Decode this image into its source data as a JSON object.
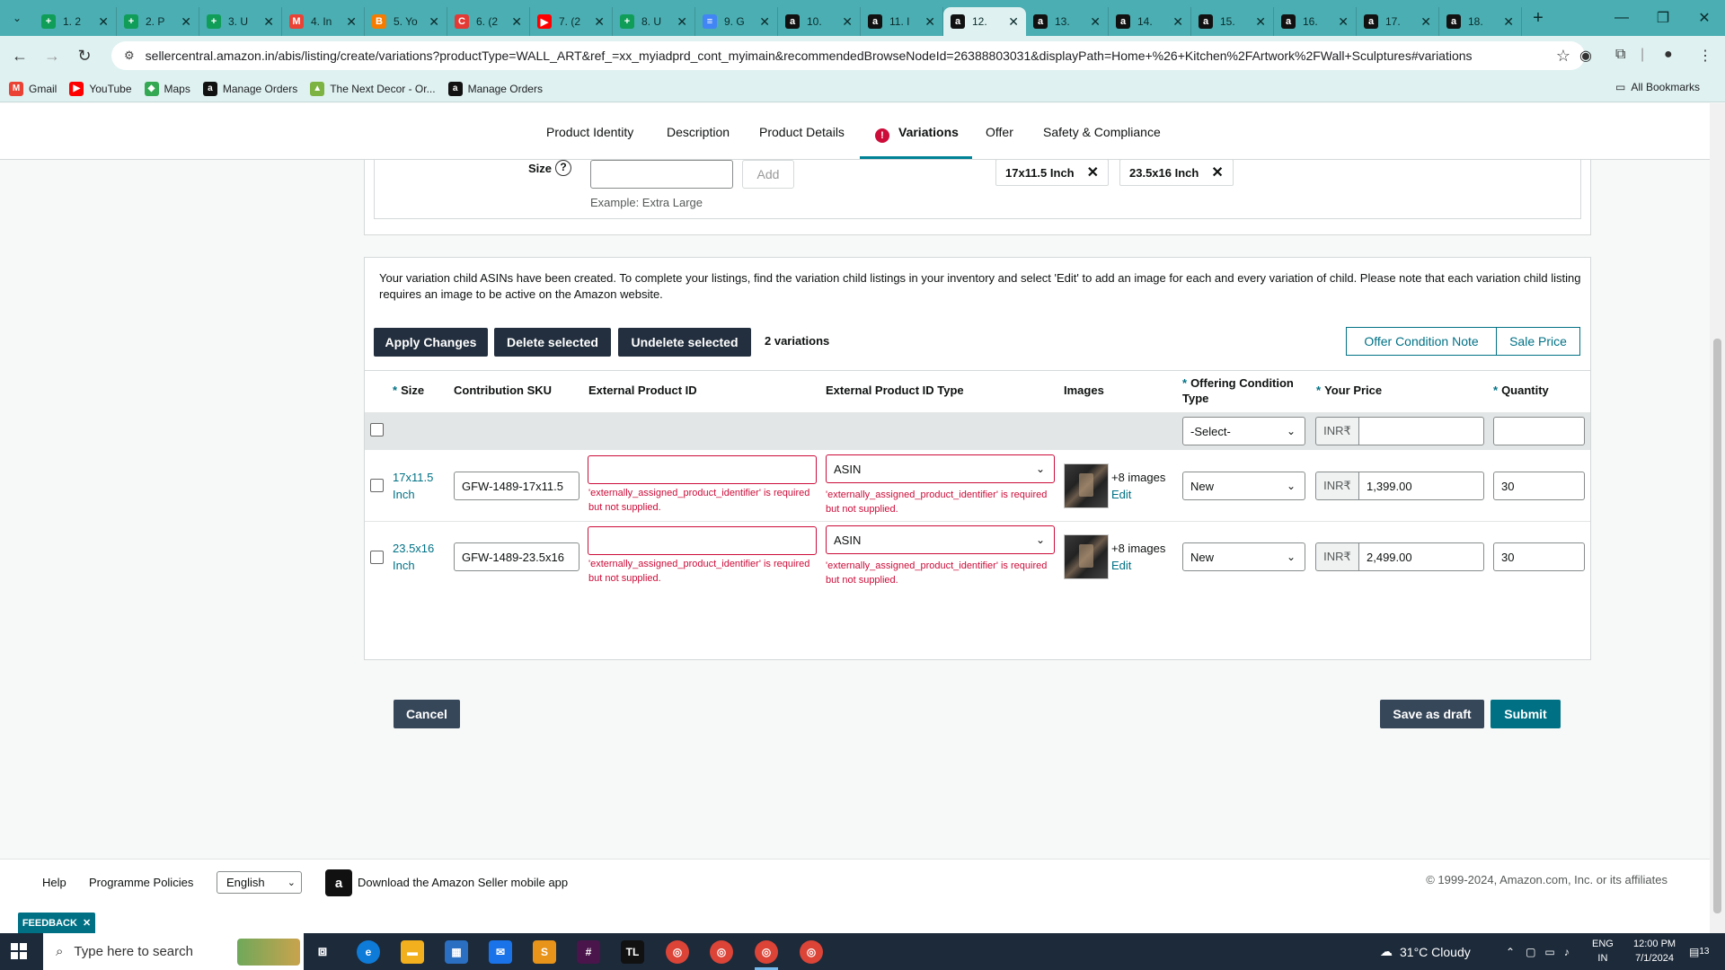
{
  "browser": {
    "tabs": [
      {
        "label": "1. 2",
        "color": "#0f9d58",
        "glyph": "+"
      },
      {
        "label": "2. P",
        "color": "#0f9d58",
        "glyph": "+"
      },
      {
        "label": "3. U",
        "color": "#0f9d58",
        "glyph": "+"
      },
      {
        "label": "4. In",
        "color": "#ea4335",
        "glyph": "M"
      },
      {
        "label": "5. Yo",
        "color": "#f57c00",
        "glyph": "B"
      },
      {
        "label": "6. (2",
        "color": "#e53935",
        "glyph": "C"
      },
      {
        "label": "7. (2",
        "color": "#ff0000",
        "glyph": "▶"
      },
      {
        "label": "8. U",
        "color": "#0f9d58",
        "glyph": "+"
      },
      {
        "label": "9. G",
        "color": "#4285f4",
        "glyph": "≡"
      },
      {
        "label": "10.",
        "color": "#111111",
        "glyph": "a"
      },
      {
        "label": "11. I",
        "color": "#111111",
        "glyph": "a"
      },
      {
        "label": "12.",
        "color": "#111111",
        "glyph": "a",
        "active": true
      },
      {
        "label": "13.",
        "color": "#111111",
        "glyph": "a"
      },
      {
        "label": "14.",
        "color": "#111111",
        "glyph": "a"
      },
      {
        "label": "15.",
        "color": "#111111",
        "glyph": "a"
      },
      {
        "label": "16.",
        "color": "#111111",
        "glyph": "a"
      },
      {
        "label": "17.",
        "color": "#111111",
        "glyph": "a"
      },
      {
        "label": "18.",
        "color": "#111111",
        "glyph": "a"
      }
    ],
    "url": "sellercentral.amazon.in/abis/listing/create/variations?productType=WALL_ART&ref_=xx_myiadprd_cont_myimain&recommendedBrowseNodeId=26388803031&displayPath=Home+%26+Kitchen%2FArtwork%2FWall+Sculptures#variations",
    "bookmarks": [
      {
        "label": "Gmail",
        "color": "#ea4335",
        "glyph": "M"
      },
      {
        "label": "YouTube",
        "color": "#ff0000",
        "glyph": "▶"
      },
      {
        "label": "Maps",
        "color": "#34a853",
        "glyph": "◆"
      },
      {
        "label": "Manage Orders",
        "color": "#111111",
        "glyph": "a"
      },
      {
        "label": "The Next Decor - Or...",
        "color": "#7cb342",
        "glyph": "▲"
      },
      {
        "label": "Manage Orders",
        "color": "#111111",
        "glyph": "a"
      }
    ],
    "all_bookmarks": "All Bookmarks"
  },
  "subnav": {
    "items": [
      "Product Identity",
      "Description",
      "Product Details",
      "Variations",
      "Offer",
      "Safety & Compliance"
    ],
    "alert": "!"
  },
  "size_section": {
    "label": "Size",
    "add": "Add",
    "example": "Example: Extra Large",
    "chips": [
      "17x11.5 Inch",
      "23.5x16 Inch"
    ]
  },
  "notice": "Your variation child ASINs have been created. To complete your listings, find the variation child listings in your inventory and select 'Edit' to add an image for each and every variation of child. Please note that each variation child listing requires an image to be active on the Amazon website.",
  "actions": {
    "apply": "Apply Changes",
    "delete": "Delete selected",
    "undelete": "Undelete selected",
    "count": "2 variations",
    "offer_note": "Offer Condition Note",
    "sale_price": "Sale Price"
  },
  "table": {
    "headers": {
      "size": "Size",
      "sku": "Contribution SKU",
      "ext_id": "External Product ID",
      "ext_type": "External Product ID Type",
      "images": "Images",
      "condition_1": "Offering Condition",
      "condition_2": "Type",
      "price": "Your Price",
      "qty": "Quantity"
    },
    "bulk": {
      "condition": "-Select-",
      "currency": "INR₹"
    },
    "rows": [
      {
        "size_1": "17x11.5",
        "size_2": "Inch",
        "sku": "GFW-1489-17x11.5",
        "ext_id": "",
        "ext_id_error": "'externally_assigned_product_identifier' is required but not supplied.",
        "ext_type": "ASIN",
        "ext_type_error": "'externally_assigned_product_identifier' is required but not supplied.",
        "images": "+8 images",
        "edit": "Edit",
        "condition": "New",
        "currency": "INR₹",
        "price": "1,399.00",
        "qty": "30"
      },
      {
        "size_1": "23.5x16",
        "size_2": "Inch",
        "sku": "GFW-1489-23.5x16",
        "ext_id": "",
        "ext_id_error": "'externally_assigned_product_identifier' is required but not supplied.",
        "ext_type": "ASIN",
        "ext_type_error": "'externally_assigned_product_identifier' is required but not supplied.",
        "images": "+8 images",
        "edit": "Edit",
        "condition": "New",
        "currency": "INR₹",
        "price": "2,499.00",
        "qty": "30"
      }
    ]
  },
  "bottom": {
    "cancel": "Cancel",
    "draft": "Save as draft",
    "submit": "Submit"
  },
  "footer": {
    "help": "Help",
    "policies": "Programme Policies",
    "language": "English",
    "app": "Download the Amazon Seller mobile app",
    "copyright": "© 1999-2024, Amazon.com, Inc. or its affiliates",
    "feedback": "FEEDBACK"
  },
  "taskbar": {
    "search_placeholder": "Type here to search",
    "weather": "31°C  Cloudy",
    "time": "12:00 PM",
    "date": "7/1/2024",
    "lang_1": "ENG",
    "lang_2": "IN",
    "notif": "13"
  }
}
